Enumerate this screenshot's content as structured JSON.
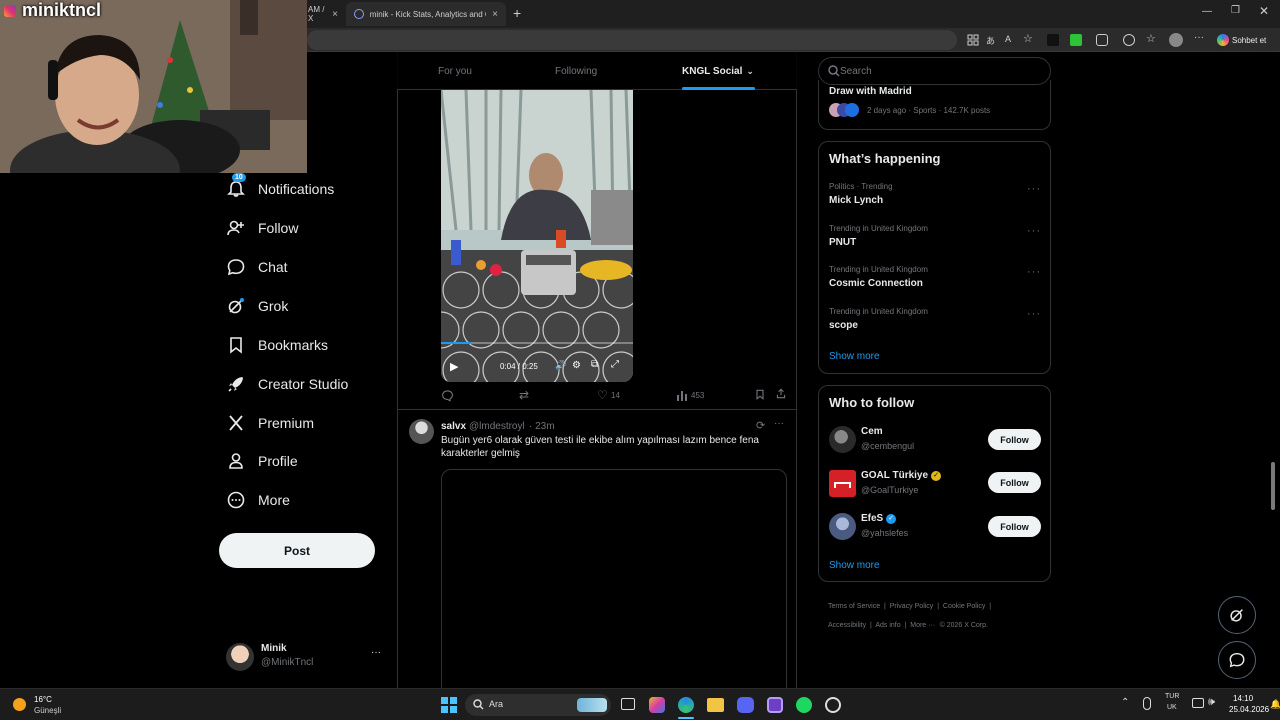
{
  "browser": {
    "tabs": [
      {
        "title": "AM / X",
        "close": "×"
      },
      {
        "title": "minik - Kick Stats, Analytics and C",
        "close": "×"
      }
    ],
    "new_tab": "+",
    "copilot_label": "Sohbet et"
  },
  "webcam": {
    "channel_name": "miniktncl"
  },
  "nav": {
    "items": [
      {
        "label": "Notifications",
        "icon": "bell-icon",
        "badge": "10"
      },
      {
        "label": "Follow",
        "icon": "add-person-icon"
      },
      {
        "label": "Chat",
        "icon": "chat-icon"
      },
      {
        "label": "Grok",
        "icon": "grok-icon"
      },
      {
        "label": "Bookmarks",
        "icon": "bookmark-icon"
      },
      {
        "label": "Creator Studio",
        "icon": "rocket-icon"
      },
      {
        "label": "Premium",
        "icon": "x-logo-icon"
      },
      {
        "label": "Profile",
        "icon": "person-icon"
      },
      {
        "label": "More",
        "icon": "more-circle-icon"
      }
    ],
    "post_button": "Post",
    "account": {
      "name": "Minik",
      "handle": "@MinikTncl",
      "menu": "···"
    }
  },
  "feed": {
    "tabs": [
      {
        "label": "For you",
        "active": false
      },
      {
        "label": "Following",
        "active": false
      },
      {
        "label": "KNGL Social",
        "active": true
      }
    ],
    "video_post": {
      "video_time": "0:04 / 0:25",
      "actions": {
        "replies": "",
        "reposts": "",
        "likes": "14",
        "views": "453"
      }
    },
    "text_post": {
      "name": "salvx",
      "handle": "@lmdestroyl",
      "time": "· 23m",
      "text": "Bugün yer6 olarak güven testi ile ekibe alım yapılması lazım bence fena karakterler gelmiş",
      "menu": "···"
    }
  },
  "sidebar": {
    "search_placeholder": "Search",
    "top_event": {
      "title": "Draw with Madrid",
      "meta": "2 days ago · Sports · 142.7K posts"
    },
    "whats_happening": {
      "heading": "What’s happening",
      "trends": [
        {
          "meta": "Politics · Trending",
          "name": "Mick Lynch"
        },
        {
          "meta": "Trending in United Kingdom",
          "name": "PNUT"
        },
        {
          "meta": "Trending in United Kingdom",
          "name": "Cosmic Connection"
        },
        {
          "meta": "Trending in United Kingdom",
          "name": "scope"
        }
      ],
      "show_more": "Show more"
    },
    "who_to_follow": {
      "heading": "Who to follow",
      "users": [
        {
          "name": "Cem",
          "handle": "@cembengul",
          "verified": false,
          "button": "Follow"
        },
        {
          "name": "GOAL Türkiye",
          "handle": "@GoalTurkiye",
          "verified": true,
          "verified_color": "#e2b719",
          "button": "Follow"
        },
        {
          "name": "EfeS",
          "handle": "@yahslefes",
          "verified": true,
          "verified_color": "#1d9bf0",
          "button": "Follow"
        }
      ],
      "show_more": "Show more"
    },
    "footer": {
      "links": [
        "Terms of Service",
        "Privacy Policy",
        "Cookie Policy",
        "Accessibility",
        "Ads info",
        "More ···"
      ],
      "copyright": "© 2026 X Corp."
    }
  },
  "taskbar": {
    "weather_temp": "16°C",
    "weather_desc": "Güneşli",
    "search_label": "Ara",
    "lang_top": "TUR",
    "lang_bottom": "UK",
    "time": "14:10",
    "date": "25.04.2026"
  },
  "colors": {
    "accent": "#1d9bf0",
    "background": "#000000",
    "border": "#2f3336"
  }
}
